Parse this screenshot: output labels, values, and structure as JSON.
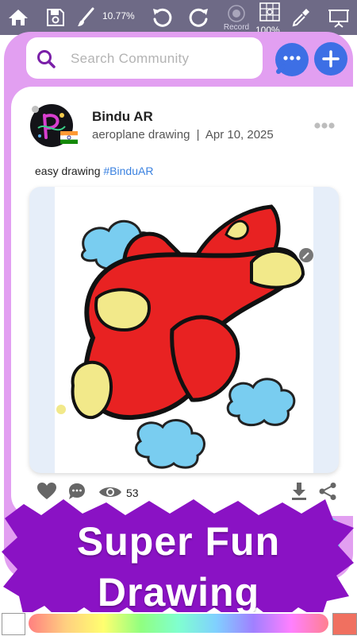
{
  "toolbar": {
    "items": [
      {
        "icon": "home-icon"
      },
      {
        "icon": "save-icon"
      },
      {
        "icon": "brush-icon"
      },
      {
        "icon": "undo-icon"
      },
      {
        "icon": "redo-icon"
      },
      {
        "icon": "record-icon"
      },
      {
        "icon": "grid-icon"
      },
      {
        "icon": "eyedropper-icon"
      },
      {
        "icon": "presentation-icon"
      }
    ],
    "zoom_label": "10.77%",
    "record_label": "Record",
    "grid_percent": "100%"
  },
  "search": {
    "placeholder": "Search Community"
  },
  "post": {
    "username": "Bindu AR",
    "title": "aeroplane drawing",
    "separator": "|",
    "date": "Apr 10, 2025",
    "caption_text": "easy drawing",
    "caption_tag": "#BinduAR",
    "views": "53"
  },
  "banner": {
    "line1": "Super Fun",
    "line2": "Drawing"
  },
  "colors": {
    "toolbar_bg": "#6e6a86",
    "panel_bg": "#e29ff1",
    "accent_blue": "#3d6fe5",
    "banner_purple": "#8a12c4"
  }
}
